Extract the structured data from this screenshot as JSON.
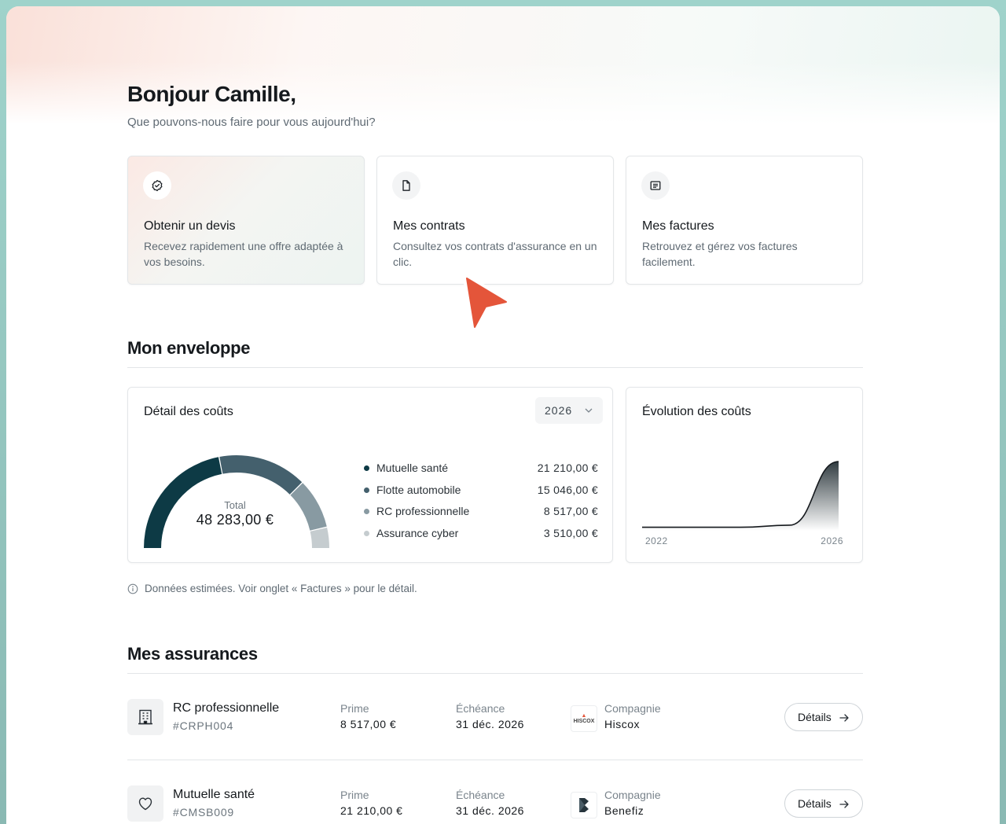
{
  "header": {
    "greeting": "Bonjour Camille,",
    "subtitle": "Que pouvons-nous faire pour vous aujourd'hui?"
  },
  "quick_actions": [
    {
      "title": "Obtenir un devis",
      "description": "Recevez rapidement une offre adaptée à vos besoins.",
      "icon": "badge-check-icon"
    },
    {
      "title": "Mes contrats",
      "description": "Consultez vos contrats d'assurance en un clic.",
      "icon": "document-icon"
    },
    {
      "title": "Mes factures",
      "description": "Retrouvez et gérez vos factures facilement.",
      "icon": "invoice-icon"
    }
  ],
  "envelope": {
    "section_title": "Mon enveloppe",
    "cost_detail": {
      "title": "Détail des coûts",
      "year": "2026",
      "total_label": "Total",
      "total_value": "48 283,00 €"
    },
    "cost_evolution": {
      "title": "Évolution des coûts",
      "x_start": "2022",
      "x_end": "2026"
    },
    "note": "Données estimées. Voir onglet « Factures » pour le détail."
  },
  "chart_data": [
    {
      "type": "pie",
      "variant": "half-donut",
      "title": "Détail des coûts",
      "categories": [
        "Mutuelle santé",
        "Flotte automobile",
        "RC professionnelle",
        "Assurance cyber"
      ],
      "values": [
        21210.0,
        15046.0,
        8517.0,
        3510.0
      ],
      "value_labels": [
        "21 210,00 €",
        "15 046,00 €",
        "8 517,00 €",
        "3 510,00 €"
      ],
      "colors": [
        "#0d3a45",
        "#44606d",
        "#889aa2",
        "#c5cccf"
      ]
    },
    {
      "type": "area",
      "title": "Évolution des coûts",
      "x": [
        "2022",
        "2023",
        "2024",
        "2025",
        "2026"
      ],
      "values": [
        5,
        5,
        5,
        8,
        100
      ],
      "xlabel": "",
      "ylabel": "",
      "grid": false
    }
  ],
  "insurances": {
    "section_title": "Mes assurances",
    "columns": {
      "premium": "Prime",
      "due": "Échéance",
      "company": "Compagnie"
    },
    "details_label": "Détails",
    "items": [
      {
        "name": "RC professionnelle",
        "code": "#CRPH004",
        "premium": "8 517,00 €",
        "due": "31 déc. 2026",
        "company": "Hiscox",
        "logo_text": "HISCOX",
        "icon": "building-icon"
      },
      {
        "name": "Mutuelle santé",
        "code": "#CMSB009",
        "premium": "21 210,00 €",
        "due": "31 déc. 2026",
        "company": "Benefiz",
        "logo_text": "",
        "icon": "heart-icon"
      }
    ]
  },
  "colors": {
    "accent_cursor": "#e4553a",
    "donut_dark": "#0d3a45",
    "text_primary": "#15191d",
    "text_secondary": "#5f6a73"
  }
}
